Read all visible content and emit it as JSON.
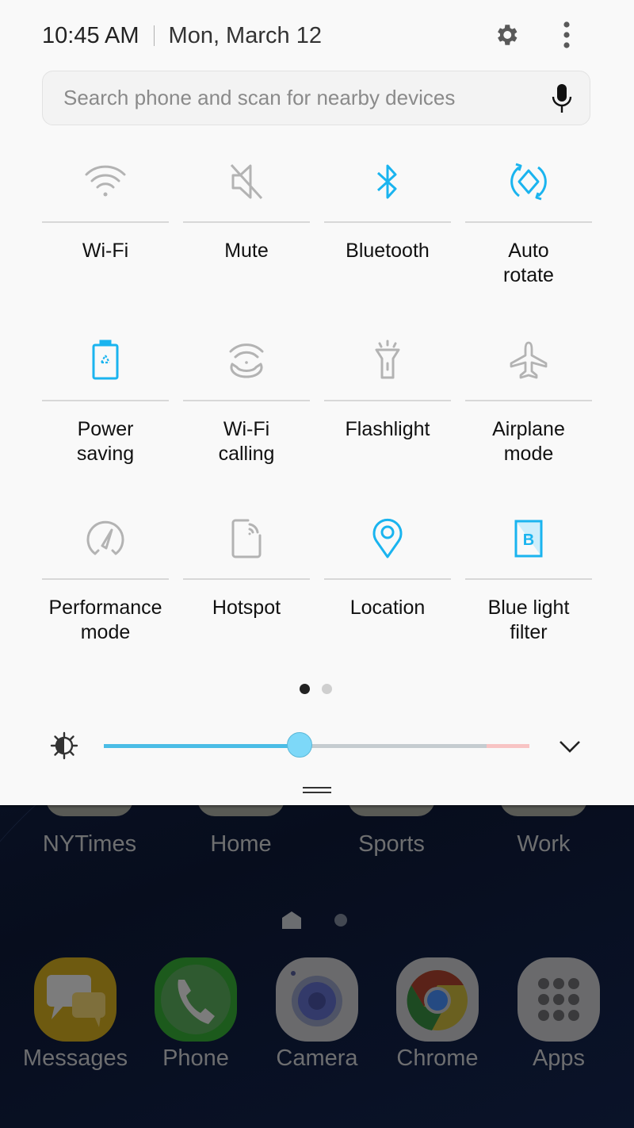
{
  "header": {
    "time": "10:45 AM",
    "date": "Mon, March 12",
    "settings_icon": "gear-icon",
    "more_icon": "more-vertical-icon"
  },
  "search": {
    "placeholder": "Search phone and scan for nearby devices",
    "value": "",
    "mic_icon": "microphone-icon"
  },
  "accent_color": "#1ab4ef",
  "inactive_color": "#b3b3b3",
  "quick_settings": [
    {
      "label": "Wi-Fi",
      "icon": "wifi-icon",
      "active": false
    },
    {
      "label": "Mute",
      "icon": "mute-icon",
      "active": false
    },
    {
      "label": "Bluetooth",
      "icon": "bluetooth-icon",
      "active": true
    },
    {
      "label": "Auto\nrotate",
      "icon": "auto-rotate-icon",
      "active": true
    },
    {
      "label": "Power\nsaving",
      "icon": "power-saving-icon",
      "active": true
    },
    {
      "label": "Wi-Fi\ncalling",
      "icon": "wifi-calling-icon",
      "active": false
    },
    {
      "label": "Flashlight",
      "icon": "flashlight-icon",
      "active": false
    },
    {
      "label": "Airplane\nmode",
      "icon": "airplane-icon",
      "active": false
    },
    {
      "label": "Performance\nmode",
      "icon": "performance-icon",
      "active": false
    },
    {
      "label": "Hotspot",
      "icon": "hotspot-icon",
      "active": false
    },
    {
      "label": "Location",
      "icon": "location-icon",
      "active": true
    },
    {
      "label": "Blue light\nfilter",
      "icon": "blue-light-filter-icon",
      "active": true
    }
  ],
  "pager": {
    "pages": 2,
    "current": 1
  },
  "brightness": {
    "level": 0.46,
    "warning_from": 0.9,
    "icon": "brightness-icon",
    "expand_icon": "chevron-down-icon"
  },
  "home": {
    "folders": [
      "NYTimes",
      "Home",
      "Sports",
      "Work"
    ],
    "page_indicator": {
      "pages": 2,
      "current": "home"
    },
    "dock": [
      {
        "label": "Messages",
        "icon": "messages-icon"
      },
      {
        "label": "Phone",
        "icon": "phone-icon"
      },
      {
        "label": "Camera",
        "icon": "camera-icon"
      },
      {
        "label": "Chrome",
        "icon": "chrome-icon"
      },
      {
        "label": "Apps",
        "icon": "apps-grid-icon"
      }
    ]
  }
}
